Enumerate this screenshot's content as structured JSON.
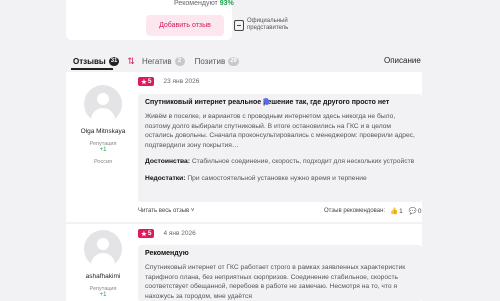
{
  "summary": {
    "recommend_label": "Рекомендуют",
    "recommend_value": "93%",
    "add_review_label": "Добавить отзыв",
    "official_label": "Официальный представитель"
  },
  "tabs": {
    "reviews": {
      "label": "Отзывы",
      "count": "31"
    },
    "negative": {
      "label": "Негатив",
      "count": "2"
    },
    "positive": {
      "label": "Позитив",
      "count": "29"
    },
    "description": "Описание"
  },
  "reviews": [
    {
      "author": "Olga Mitnskaya",
      "reputation_label": "Репутация",
      "reputation": "+1",
      "country": "Россия",
      "rating": "5",
      "date": "23 янв 2026",
      "title": "Спутниковый интернет реальное решение так, где другого просто нет",
      "text": "Живём в поселке, и вариантов с проводным интернетом здесь никогда не было, поэтому долго выбирали спутниковый. В итоге остановились на ГКС и в целом остались довольны. Сначала проконсультировались с менеджером: проверили адрес, подтвердили зону покрытия…",
      "pros_label": "Достоинства:",
      "pros": "Стабильное соединение, скорость, подходит для нескольких устройств",
      "cons_label": "Недостатки:",
      "cons": "При самостоятельной установке нужно время и терпение",
      "read_all": "Читать весь отзыв ˅",
      "helpful": "Отзыв рекомендован:",
      "likes": "1",
      "comments": "0"
    },
    {
      "author": "ashafhakimi",
      "reputation_label": "Репутация",
      "reputation": "+1",
      "rating": "5",
      "date": "4 янв 2026",
      "title": "Рекомендую",
      "text": "Спутниковый интернет от ГКС работает строго в рамках заявленных характеристик тарифного плана, без неприятных сюрпризов. Соединение стабильное, скорость соответствует обещанной, перебоев в работе не замечаю. Несмотря на то, что я нахожусь за городом, мне удаётся"
    }
  ],
  "colors": {
    "accent": "#d4175e",
    "positive": "#1aa34a",
    "star_badge": "#e0185c"
  },
  "icons": {
    "star": "★",
    "like": "thumbs-up-icon",
    "comment": "comment-icon"
  }
}
